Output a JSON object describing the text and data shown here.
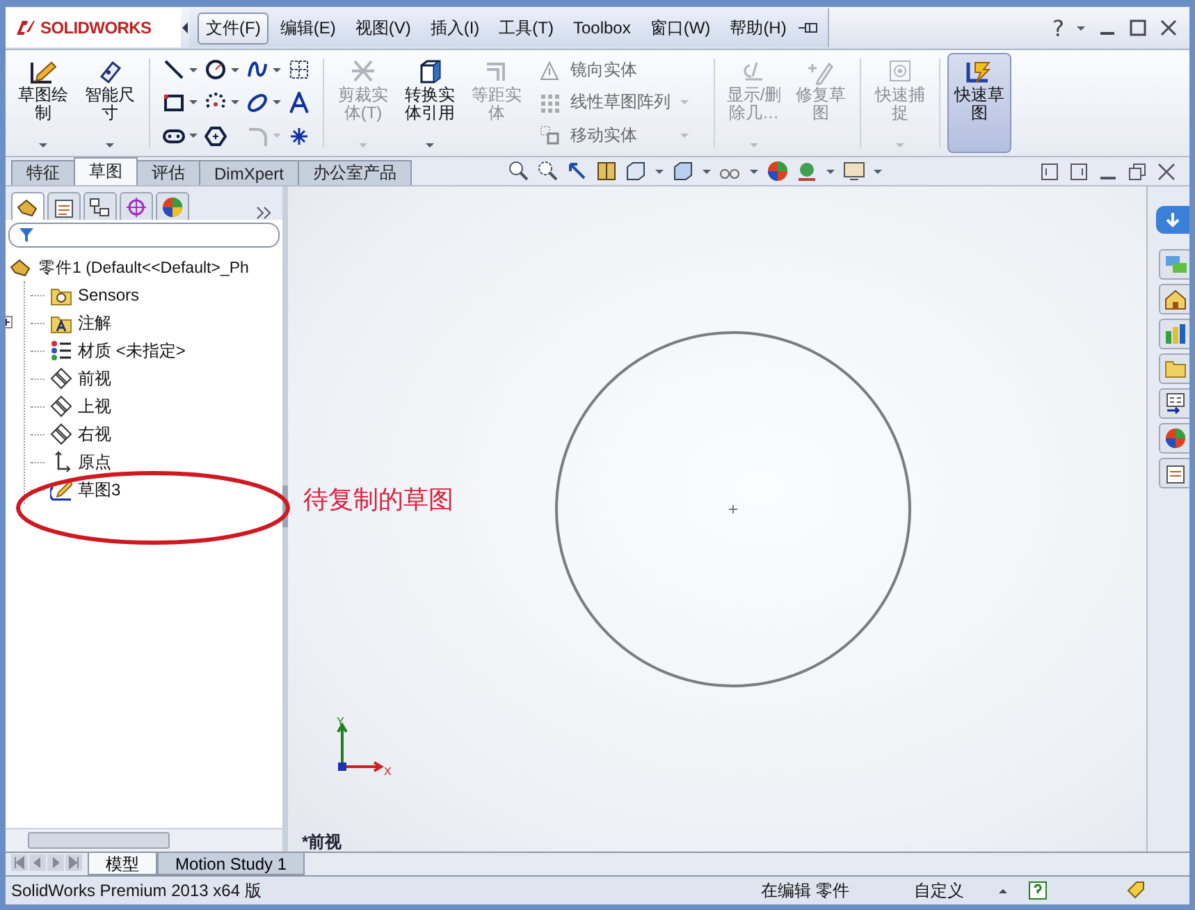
{
  "app": {
    "logo": "SOLIDWORKS"
  },
  "menu": [
    {
      "label": "文件(F)",
      "selected": true
    },
    {
      "label": "编辑(E)",
      "selected": false
    },
    {
      "label": "视图(V)",
      "selected": false
    },
    {
      "label": "插入(I)",
      "selected": false
    },
    {
      "label": "工具(T)",
      "selected": false
    },
    {
      "label": "Toolbox",
      "selected": false
    },
    {
      "label": "窗口(W)",
      "selected": false
    },
    {
      "label": "帮助(H)",
      "selected": false
    }
  ],
  "help": {
    "label": "?"
  },
  "ribbon": [
    {
      "kind": "large",
      "label": "草图绘制",
      "disabled": false,
      "selected": false,
      "caret": true
    },
    {
      "kind": "large",
      "label": "智能尺寸",
      "disabled": false,
      "selected": false,
      "caret": true
    },
    {
      "kind": "grid"
    },
    {
      "kind": "large",
      "label": "剪裁实体(T)",
      "disabled": true,
      "selected": false,
      "caret": true
    },
    {
      "kind": "large",
      "label": "转换实体引用",
      "disabled": false,
      "selected": false,
      "caret": true
    },
    {
      "kind": "large",
      "label": "等距实体",
      "disabled": true,
      "selected": false,
      "caret": false
    },
    {
      "kind": "list",
      "items": [
        {
          "label": "镜向实体",
          "disabled": true,
          "caret": false
        },
        {
          "label": "线性草图阵列",
          "disabled": true,
          "caret": true
        },
        {
          "label": "移动实体",
          "disabled": true,
          "caret": true
        }
      ]
    },
    {
      "kind": "large",
      "label": "显示/删除几…",
      "disabled": true,
      "selected": false,
      "caret": true
    },
    {
      "kind": "large",
      "label": "修复草图",
      "disabled": true,
      "selected": false,
      "caret": false
    },
    {
      "kind": "large",
      "label": "快速捕捉",
      "disabled": true,
      "selected": false,
      "caret": true
    },
    {
      "kind": "large",
      "label": "快速草图",
      "disabled": false,
      "selected": true,
      "caret": false
    }
  ],
  "tabs": [
    {
      "label": "特征",
      "selected": false
    },
    {
      "label": "草图",
      "selected": true
    },
    {
      "label": "评估",
      "selected": false
    },
    {
      "label": "DimXpert",
      "selected": false
    },
    {
      "label": "办公室产品",
      "selected": false
    }
  ],
  "panel_tabs": [
    {
      "kind": "tree",
      "selected": true
    },
    {
      "kind": "property",
      "selected": false
    },
    {
      "kind": "config",
      "selected": false
    },
    {
      "kind": "dim",
      "selected": false
    },
    {
      "kind": "display",
      "selected": false
    }
  ],
  "tree": {
    "label": "零件1  (Default<<Default>_Ph",
    "children": [
      {
        "kind": "sensors",
        "label": "Sensors",
        "expandable": false
      },
      {
        "kind": "annotations",
        "label": "注解",
        "expandable": true
      },
      {
        "kind": "material",
        "label": "材质 <未指定>",
        "expandable": false
      },
      {
        "kind": "plane",
        "label": "前视",
        "expandable": false
      },
      {
        "kind": "plane",
        "label": "上视",
        "expandable": false
      },
      {
        "kind": "plane",
        "label": "右视",
        "expandable": false
      },
      {
        "kind": "origin",
        "label": "原点",
        "expandable": false
      },
      {
        "kind": "sketch",
        "label": "草图3",
        "expandable": false
      }
    ]
  },
  "annotation": {
    "text": "待复制的草图"
  },
  "viewport": {
    "view_label": "*前视",
    "triad": {
      "x": "X",
      "y": "Y"
    }
  },
  "bottom_tabs": [
    {
      "label": "模型",
      "selected": true
    },
    {
      "label": "Motion Study 1",
      "selected": false
    }
  ],
  "status_bar": {
    "product": "SolidWorks Premium 2013 x64 版",
    "mode": "在编辑 零件",
    "units": "自定义"
  }
}
